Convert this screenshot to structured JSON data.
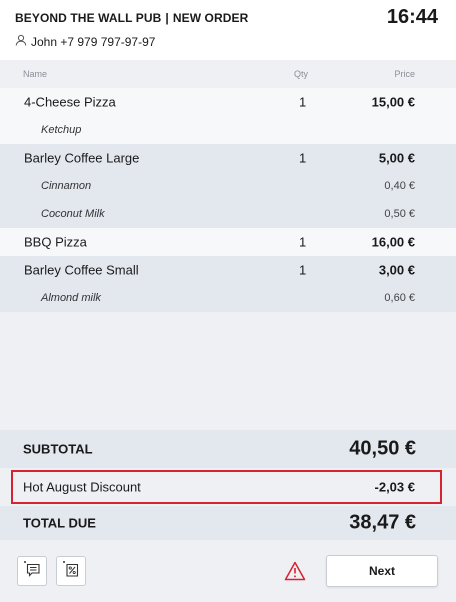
{
  "header": {
    "venue": "BEYOND THE WALL PUB",
    "separator": "|",
    "mode": "NEW ORDER",
    "time": "16:44",
    "customer": "John +7 979 797-97-97",
    "customer_icon": "user-icon"
  },
  "columns": {
    "name": "Name",
    "qty": "Qty",
    "price": "Price"
  },
  "order_rows": [
    {
      "type": "item",
      "name": "4-Cheese Pizza",
      "qty": "1",
      "price": "15,00 €"
    },
    {
      "type": "mod",
      "name": "Ketchup",
      "qty": "",
      "price": ""
    },
    {
      "type": "item",
      "name": "Barley Coffee Large",
      "qty": "1",
      "price": "5,00 €"
    },
    {
      "type": "mod",
      "name": "Cinnamon",
      "qty": "",
      "price": "0,40 €"
    },
    {
      "type": "mod",
      "name": "Coconut Milk",
      "qty": "",
      "price": "0,50 €"
    },
    {
      "type": "item",
      "name": "BBQ Pizza",
      "qty": "1",
      "price": "16,00 €"
    },
    {
      "type": "item",
      "name": "Barley Coffee Small",
      "qty": "1",
      "price": "3,00 €"
    },
    {
      "type": "mod",
      "name": "Almond milk",
      "qty": "",
      "price": "0,60 €"
    }
  ],
  "totals": {
    "subtotal_label": "SUBTOTAL",
    "subtotal_value": "40,50 €",
    "discount_label": "Hot August Discount",
    "discount_value": "-2,03 €",
    "total_label": "TOTAL DUE",
    "total_value": "38,47 €"
  },
  "footer": {
    "comment_icon": "add-comment-icon",
    "discount_icon": "add-discount-icon",
    "warning_icon": "warning-icon",
    "next_label": "Next"
  },
  "colors": {
    "highlight_border": "#d6232f",
    "warning": "#d6232f"
  }
}
